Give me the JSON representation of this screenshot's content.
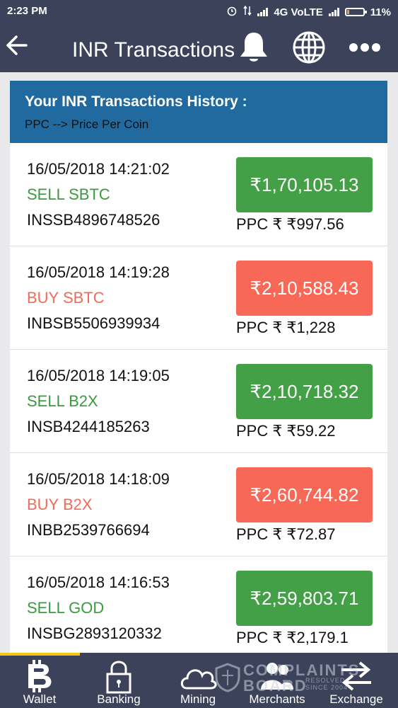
{
  "status_bar": {
    "time": "2:23 PM",
    "network": "4G VoLTE",
    "battery": "11%"
  },
  "app_bar": {
    "back_icon": "arrow-left-icon",
    "title": "INR Transactions",
    "icons": [
      "bell-icon",
      "globe-icon",
      "more-icon"
    ]
  },
  "history": {
    "heading": "Your INR Transactions History :",
    "subheading": "PPC --> Price Per Coin"
  },
  "transactions": [
    {
      "datetime": "16/05/2018 14:21:02",
      "type": "SELL SBTC",
      "txid": "INSSB4896748526",
      "amount": "₹1,70,105.13",
      "ppc": "PPC ₹ ₹997.56",
      "side": "sell"
    },
    {
      "datetime": "16/05/2018 14:19:28",
      "type": "BUY SBTC",
      "txid": "INBSB5506939934",
      "amount": "₹2,10,588.43",
      "ppc": "PPC ₹ ₹1,228",
      "side": "buy"
    },
    {
      "datetime": "16/05/2018 14:19:05",
      "type": "SELL B2X",
      "txid": "INSB4244185263",
      "amount": "₹2,10,718.32",
      "ppc": "PPC ₹ ₹59.22",
      "side": "sell"
    },
    {
      "datetime": "16/05/2018 14:18:09",
      "type": "BUY B2X",
      "txid": "INBB2539766694",
      "amount": "₹2,60,744.82",
      "ppc": "PPC ₹ ₹72.87",
      "side": "buy"
    },
    {
      "datetime": "16/05/2018 14:16:53",
      "type": "SELL GOD",
      "txid": "INSBG2893120332",
      "amount": "₹2,59,803.71",
      "ppc": "PPC ₹ ₹2,179.1",
      "side": "sell"
    }
  ],
  "bottom_nav": [
    {
      "label": "Wallet",
      "icon": "bitcoin-icon",
      "active": true
    },
    {
      "label": "Banking",
      "icon": "lock-icon",
      "active": false
    },
    {
      "label": "Mining",
      "icon": "cloud-icon",
      "active": false
    },
    {
      "label": "Merchants",
      "icon": "users-icon",
      "active": false
    },
    {
      "label": "Exchange",
      "icon": "exchange-arrows-icon",
      "active": false
    }
  ],
  "watermark": {
    "text_line1": "COMPLAINTS",
    "text_line2": "BOARD",
    "small1": "RESOLVED",
    "small2": "SINCE 2004"
  },
  "colors": {
    "app_bar": "#3b4259",
    "history_header": "#216aa0",
    "sell": "#43a047",
    "buy": "#f76857",
    "active_indicator": "#f5c518"
  }
}
